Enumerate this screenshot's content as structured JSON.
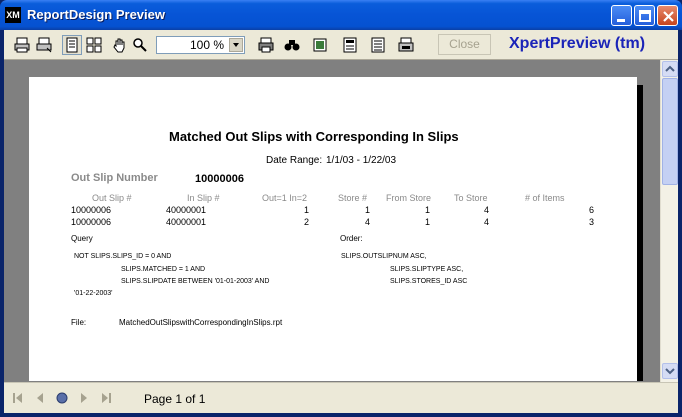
{
  "window": {
    "title": "ReportDesign Preview",
    "icon_name": "app-icon",
    "icon_glyph": "XM"
  },
  "toolbar": {
    "zoom_value": "100 %",
    "close_label": "Close",
    "brand": "XpertPreview (tm)"
  },
  "report": {
    "title": "Matched Out Slips with Corresponding In Slips",
    "date_range_label": "Date Range:",
    "date_range_value": "1/1/03 - 1/22/03",
    "group_label": "Out Slip Number",
    "group_value": "10000006",
    "columns": [
      "Out Slip #",
      "In Slip #",
      "Out=1 In=2",
      "Store #",
      "From Store",
      "To Store",
      "# of Items"
    ],
    "rows": [
      [
        "10000006",
        "40000001",
        "1",
        "1",
        "1",
        "4",
        "6"
      ],
      [
        "10000006",
        "40000001",
        "2",
        "4",
        "1",
        "4",
        "3"
      ]
    ],
    "query_label": "Query",
    "order_label": "Order:",
    "query_lines": [
      "NOT SLIPS.SLIPS_ID = 0 AND",
      "SLIPS.MATCHED = 1 AND",
      "SLIPS.SLIPDATE BETWEEN '01-01-2003' AND",
      "'01-22-2003'"
    ],
    "order_lines": [
      "SLIPS.OUTSLIPNUM ASC,",
      "SLIPS.SLIPTYPE ASC,",
      "SLIPS.STORES_ID ASC"
    ],
    "file_label": "File:",
    "file_value": "MatchedOutSlipswithCorrespondingInSlips.rpt"
  },
  "status": {
    "page_label": "Page 1 of 1"
  }
}
